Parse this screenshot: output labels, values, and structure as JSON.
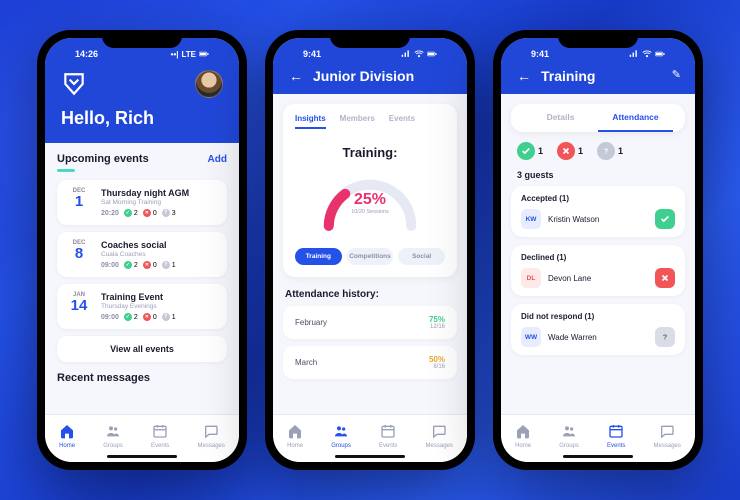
{
  "phone1": {
    "status_time": "14:26",
    "signal_label": "LTE",
    "greeting": "Hello, Rich",
    "upcoming_title": "Upcoming events",
    "add_label": "Add",
    "events": [
      {
        "month": "Dec",
        "day": "1",
        "title": "Thursday night AGM",
        "sub": "Sat Morning Training",
        "time": "20:20",
        "green": "2",
        "red": "0",
        "gray": "3"
      },
      {
        "month": "Dec",
        "day": "8",
        "title": "Coaches social",
        "sub": "Cuala Coaches",
        "time": "09:00",
        "green": "2",
        "red": "0",
        "gray": "1"
      },
      {
        "month": "Jan",
        "day": "14",
        "title": "Training Event",
        "sub": "Thursday Evenings",
        "time": "09:00",
        "green": "2",
        "red": "0",
        "gray": "1"
      }
    ],
    "view_all": "View all events",
    "recent_messages": "Recent messages",
    "nav": {
      "home": "Home",
      "groups": "Groups",
      "events": "Events",
      "messages": "Messages"
    },
    "nav_active": "Home"
  },
  "phone2": {
    "status_time": "9:41",
    "header": "Junior Division",
    "tabs": {
      "insights": "Insights",
      "members": "Members",
      "events": "Events"
    },
    "active_tab": "Insights",
    "training_title": "Training:",
    "gauge_pct": "25%",
    "gauge_sub": "10/20 Sessions",
    "segs": {
      "training": "Training",
      "competitions": "Competitions",
      "social": "Social"
    },
    "active_seg": "Training",
    "history_title": "Attendance history:",
    "history": [
      {
        "month": "February",
        "pct": "75%",
        "frac": "12/16",
        "color": "green"
      },
      {
        "month": "March",
        "pct": "50%",
        "frac": "8/16",
        "color": "yellow"
      }
    ],
    "nav": {
      "home": "Home",
      "groups": "Groups",
      "events": "Events",
      "messages": "Messages"
    },
    "nav_active": "Groups"
  },
  "phone3": {
    "status_time": "9:41",
    "header": "Training",
    "tabs": {
      "details": "Details",
      "attendance": "Attendance"
    },
    "active_tab": "Attendance",
    "status": {
      "accepted": "1",
      "declined": "1",
      "noresponse": "1"
    },
    "guests_title": "3 guests",
    "groups": [
      {
        "title": "Accepted (1)",
        "initials": "KW",
        "name": "Kristin Watson",
        "iclass": "kw",
        "action": "green"
      },
      {
        "title": "Declined (1)",
        "initials": "DL",
        "name": "Devon Lane",
        "iclass": "dl",
        "action": "red"
      },
      {
        "title": "Did not respond (1)",
        "initials": "WW",
        "name": "Wade Warren",
        "iclass": "ww",
        "action": "gray"
      }
    ],
    "nav": {
      "home": "Home",
      "groups": "Groups",
      "events": "Events",
      "messages": "Messages"
    },
    "nav_active": "Events"
  }
}
